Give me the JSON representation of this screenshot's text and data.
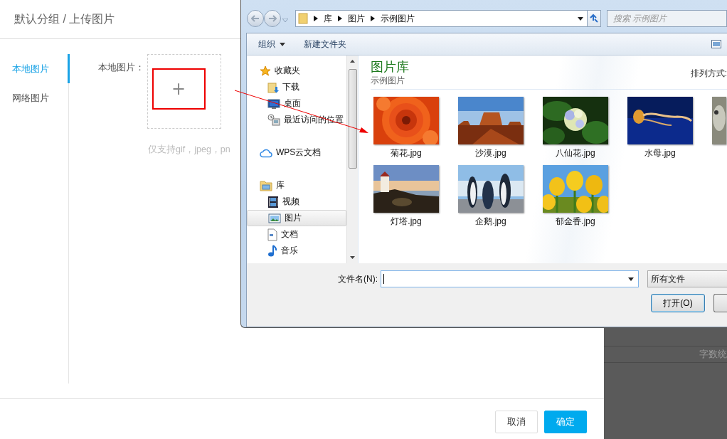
{
  "upload_modal": {
    "breadcrumb": "默认分组 / 上传图片",
    "tabs": [
      {
        "label": "本地图片",
        "selected": true
      },
      {
        "label": "网络图片",
        "selected": false
      }
    ],
    "upload": {
      "label": "本地图片：",
      "button": "+",
      "hint": "仅支持gif，jpeg，pn"
    },
    "buttons": [
      {
        "label": "取消",
        "kind": "default"
      },
      {
        "label": "确定",
        "kind": "primary"
      }
    ]
  },
  "background_panel": {
    "text": "字数统"
  },
  "file_dialog": {
    "address": [
      "库",
      "图片",
      "示例图片"
    ],
    "search": {
      "placeholder": "搜索 示例图片"
    },
    "toolbar": [
      {
        "label": "组织",
        "kind": "menu"
      },
      {
        "label": "新建文件夹",
        "kind": "button"
      }
    ],
    "nav": [
      {
        "label": "收藏夹",
        "selected": false,
        "children": [
          {
            "label": "下载",
            "selected": false
          },
          {
            "label": "桌面",
            "selected": false
          },
          {
            "label": "最近访问的位置",
            "selected": false
          }
        ]
      },
      {
        "label": "WPS云文档",
        "selected": false
      },
      {
        "label": "库",
        "selected": false,
        "children": [
          {
            "label": "视频",
            "selected": false
          },
          {
            "label": "图片",
            "selected": true
          },
          {
            "label": "文档",
            "selected": false
          },
          {
            "label": "音乐",
            "selected": false
          }
        ]
      }
    ],
    "library": {
      "title": "图片库",
      "subtitle": "示例图片",
      "arrange_label": "排列方式:"
    },
    "files": [
      {
        "name": "菊花.jpg"
      },
      {
        "name": "沙漠.jpg"
      },
      {
        "name": "八仙花.jpg"
      },
      {
        "name": "水母.jpg"
      },
      {
        "kind": "picture"
      },
      {
        "name": "灯塔.jpg"
      },
      {
        "name": "企鹅.jpg"
      },
      {
        "name": "郁金香.jpg"
      }
    ],
    "filename": {
      "label": "文件名(N):"
    },
    "filter": "所有文件",
    "buttons": [
      {
        "label": "打开(O)"
      }
    ]
  }
}
